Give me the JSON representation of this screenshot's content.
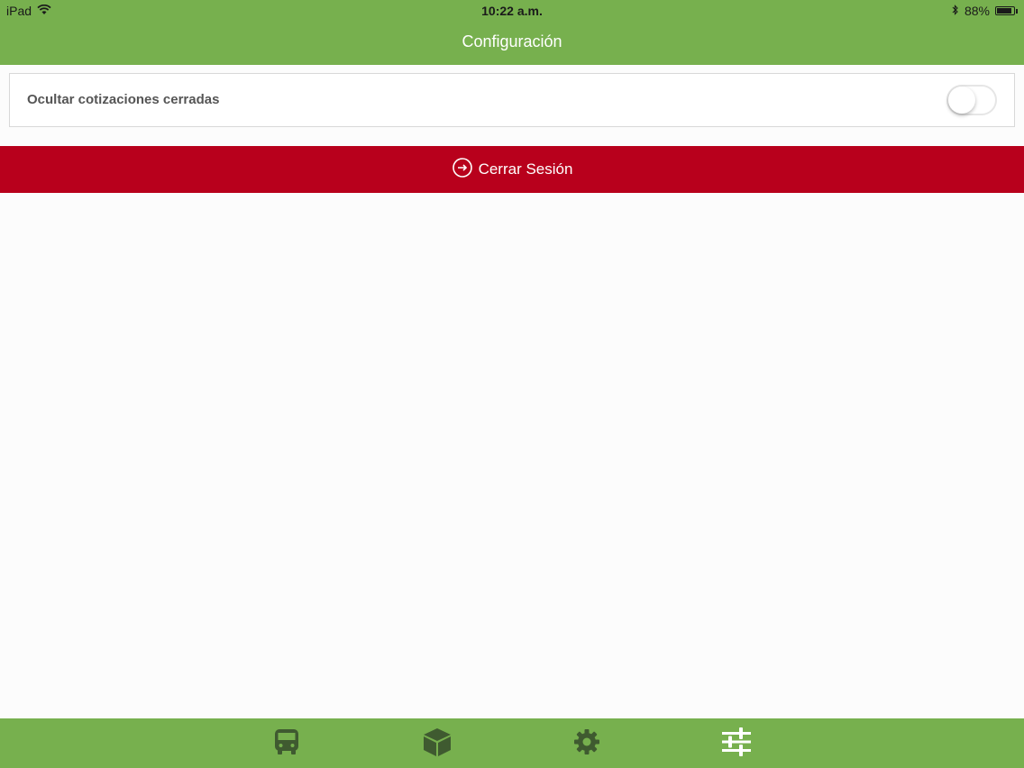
{
  "status_bar": {
    "device": "iPad",
    "time": "10:22 a.m.",
    "battery_text": "88%",
    "battery_level": 0.88,
    "icons": [
      "wifi-icon",
      "bluetooth-icon",
      "battery-icon"
    ]
  },
  "header": {
    "title": "Configuración",
    "color": "#77b04e"
  },
  "settings": {
    "hide_closed_quotes": {
      "label": "Ocultar cotizaciones cerradas",
      "enabled": false
    }
  },
  "logout": {
    "label": "Cerrar Sesión",
    "icon": "logout-icon",
    "color": "#b8001c"
  },
  "tab_bar": {
    "color": "#77b04e",
    "tabs": [
      {
        "icon": "bus-icon",
        "selected": false
      },
      {
        "icon": "box-icon",
        "selected": false
      },
      {
        "icon": "gear-icon",
        "selected": false
      },
      {
        "icon": "sliders-icon",
        "selected": true
      }
    ],
    "active_color": "#ffffff",
    "inactive_color": "#3f5a30"
  }
}
